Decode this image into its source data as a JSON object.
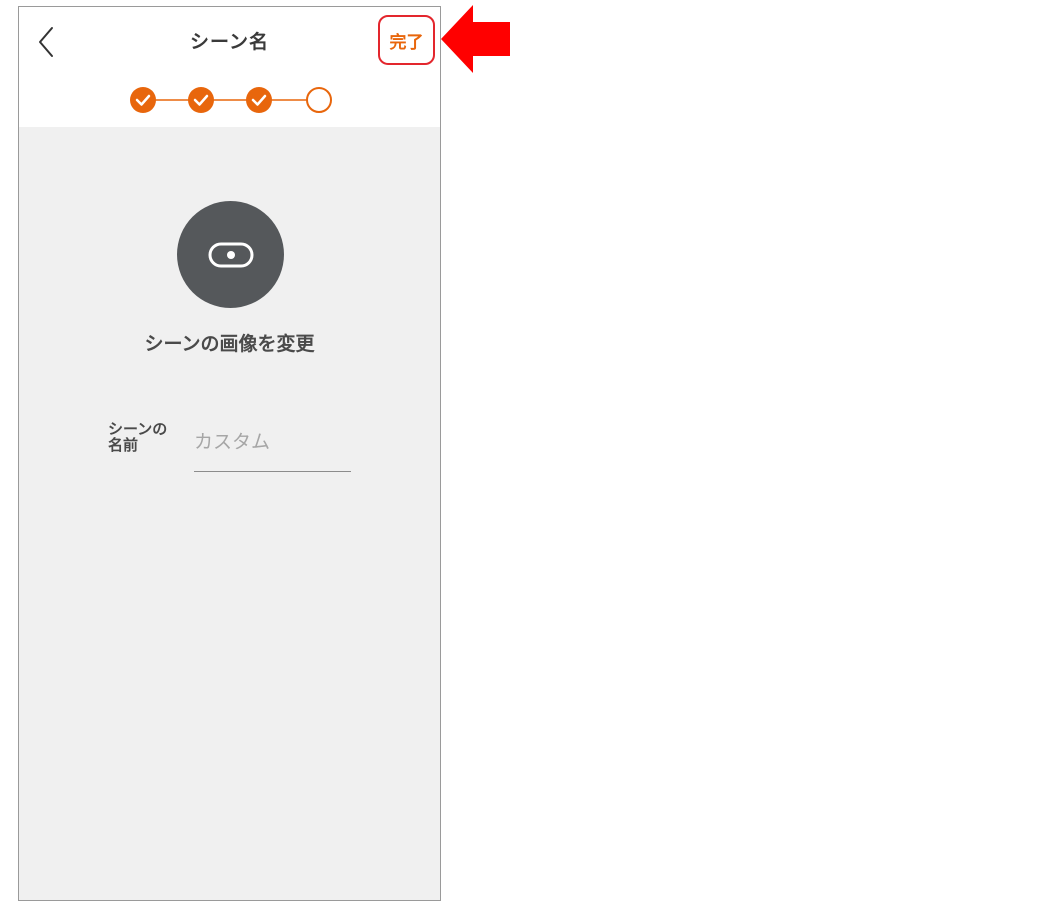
{
  "header": {
    "title": "シーン名",
    "done_label": "完了"
  },
  "stepper": {
    "steps": [
      {
        "state": "completed"
      },
      {
        "state": "completed"
      },
      {
        "state": "completed"
      },
      {
        "state": "current"
      }
    ],
    "active_color": "#e8660c"
  },
  "scene_image": {
    "icon": "scene-image-icon",
    "change_label": "シーンの画像を変更"
  },
  "scene_name": {
    "label_line1": "シーンの",
    "label_line2": "名前",
    "placeholder": "カスタム",
    "value": ""
  },
  "annotation": {
    "highlight_color": "#e3262d",
    "arrow_color": "#ff0000"
  }
}
